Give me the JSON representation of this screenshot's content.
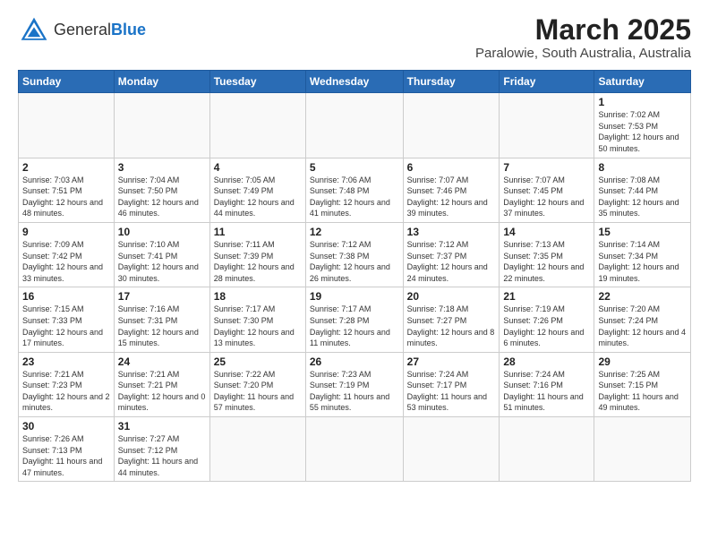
{
  "header": {
    "logo_general": "General",
    "logo_blue": "Blue",
    "main_title": "March 2025",
    "subtitle": "Paralowie, South Australia, Australia"
  },
  "weekdays": [
    "Sunday",
    "Monday",
    "Tuesday",
    "Wednesday",
    "Thursday",
    "Friday",
    "Saturday"
  ],
  "weeks": [
    [
      {
        "day": "",
        "info": ""
      },
      {
        "day": "",
        "info": ""
      },
      {
        "day": "",
        "info": ""
      },
      {
        "day": "",
        "info": ""
      },
      {
        "day": "",
        "info": ""
      },
      {
        "day": "",
        "info": ""
      },
      {
        "day": "1",
        "info": "Sunrise: 7:02 AM\nSunset: 7:53 PM\nDaylight: 12 hours\nand 50 minutes."
      }
    ],
    [
      {
        "day": "2",
        "info": "Sunrise: 7:03 AM\nSunset: 7:51 PM\nDaylight: 12 hours\nand 48 minutes."
      },
      {
        "day": "3",
        "info": "Sunrise: 7:04 AM\nSunset: 7:50 PM\nDaylight: 12 hours\nand 46 minutes."
      },
      {
        "day": "4",
        "info": "Sunrise: 7:05 AM\nSunset: 7:49 PM\nDaylight: 12 hours\nand 44 minutes."
      },
      {
        "day": "5",
        "info": "Sunrise: 7:06 AM\nSunset: 7:48 PM\nDaylight: 12 hours\nand 41 minutes."
      },
      {
        "day": "6",
        "info": "Sunrise: 7:07 AM\nSunset: 7:46 PM\nDaylight: 12 hours\nand 39 minutes."
      },
      {
        "day": "7",
        "info": "Sunrise: 7:07 AM\nSunset: 7:45 PM\nDaylight: 12 hours\nand 37 minutes."
      },
      {
        "day": "8",
        "info": "Sunrise: 7:08 AM\nSunset: 7:44 PM\nDaylight: 12 hours\nand 35 minutes."
      }
    ],
    [
      {
        "day": "9",
        "info": "Sunrise: 7:09 AM\nSunset: 7:42 PM\nDaylight: 12 hours\nand 33 minutes."
      },
      {
        "day": "10",
        "info": "Sunrise: 7:10 AM\nSunset: 7:41 PM\nDaylight: 12 hours\nand 30 minutes."
      },
      {
        "day": "11",
        "info": "Sunrise: 7:11 AM\nSunset: 7:39 PM\nDaylight: 12 hours\nand 28 minutes."
      },
      {
        "day": "12",
        "info": "Sunrise: 7:12 AM\nSunset: 7:38 PM\nDaylight: 12 hours\nand 26 minutes."
      },
      {
        "day": "13",
        "info": "Sunrise: 7:12 AM\nSunset: 7:37 PM\nDaylight: 12 hours\nand 24 minutes."
      },
      {
        "day": "14",
        "info": "Sunrise: 7:13 AM\nSunset: 7:35 PM\nDaylight: 12 hours\nand 22 minutes."
      },
      {
        "day": "15",
        "info": "Sunrise: 7:14 AM\nSunset: 7:34 PM\nDaylight: 12 hours\nand 19 minutes."
      }
    ],
    [
      {
        "day": "16",
        "info": "Sunrise: 7:15 AM\nSunset: 7:33 PM\nDaylight: 12 hours\nand 17 minutes."
      },
      {
        "day": "17",
        "info": "Sunrise: 7:16 AM\nSunset: 7:31 PM\nDaylight: 12 hours\nand 15 minutes."
      },
      {
        "day": "18",
        "info": "Sunrise: 7:17 AM\nSunset: 7:30 PM\nDaylight: 12 hours\nand 13 minutes."
      },
      {
        "day": "19",
        "info": "Sunrise: 7:17 AM\nSunset: 7:28 PM\nDaylight: 12 hours\nand 11 minutes."
      },
      {
        "day": "20",
        "info": "Sunrise: 7:18 AM\nSunset: 7:27 PM\nDaylight: 12 hours\nand 8 minutes."
      },
      {
        "day": "21",
        "info": "Sunrise: 7:19 AM\nSunset: 7:26 PM\nDaylight: 12 hours\nand 6 minutes."
      },
      {
        "day": "22",
        "info": "Sunrise: 7:20 AM\nSunset: 7:24 PM\nDaylight: 12 hours\nand 4 minutes."
      }
    ],
    [
      {
        "day": "23",
        "info": "Sunrise: 7:21 AM\nSunset: 7:23 PM\nDaylight: 12 hours\nand 2 minutes."
      },
      {
        "day": "24",
        "info": "Sunrise: 7:21 AM\nSunset: 7:21 PM\nDaylight: 12 hours\nand 0 minutes."
      },
      {
        "day": "25",
        "info": "Sunrise: 7:22 AM\nSunset: 7:20 PM\nDaylight: 11 hours\nand 57 minutes."
      },
      {
        "day": "26",
        "info": "Sunrise: 7:23 AM\nSunset: 7:19 PM\nDaylight: 11 hours\nand 55 minutes."
      },
      {
        "day": "27",
        "info": "Sunrise: 7:24 AM\nSunset: 7:17 PM\nDaylight: 11 hours\nand 53 minutes."
      },
      {
        "day": "28",
        "info": "Sunrise: 7:24 AM\nSunset: 7:16 PM\nDaylight: 11 hours\nand 51 minutes."
      },
      {
        "day": "29",
        "info": "Sunrise: 7:25 AM\nSunset: 7:15 PM\nDaylight: 11 hours\nand 49 minutes."
      }
    ],
    [
      {
        "day": "30",
        "info": "Sunrise: 7:26 AM\nSunset: 7:13 PM\nDaylight: 11 hours\nand 47 minutes."
      },
      {
        "day": "31",
        "info": "Sunrise: 7:27 AM\nSunset: 7:12 PM\nDaylight: 11 hours\nand 44 minutes."
      },
      {
        "day": "",
        "info": ""
      },
      {
        "day": "",
        "info": ""
      },
      {
        "day": "",
        "info": ""
      },
      {
        "day": "",
        "info": ""
      },
      {
        "day": "",
        "info": ""
      }
    ]
  ]
}
